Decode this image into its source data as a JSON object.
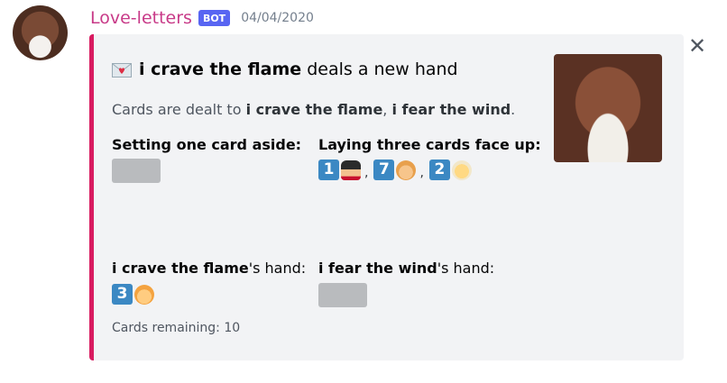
{
  "message": {
    "username": "Love-letters",
    "bot_tag": "BOT",
    "timestamp": "04/04/2020"
  },
  "embed": {
    "accent_color": "#d81b60",
    "title_icon": "love-letter-emoji",
    "title_bold": "i crave the flame",
    "title_rest": " deals a new hand",
    "desc_prefix": "Cards are dealt to ",
    "desc_player1": "i crave the flame",
    "desc_sep": ", ",
    "desc_player2": "i fear the wind",
    "desc_end": ".",
    "fields": {
      "aside_label": "Setting one card aside:",
      "faceup_label": "Laying three cards face up:",
      "faceup_cards": [
        {
          "number": "1",
          "icon": "guard-emoji"
        },
        {
          "number": "7",
          "icon": "princess-emoji"
        },
        {
          "number": "2",
          "icon": "older-person-emoji"
        }
      ],
      "faceup_separator": ",",
      "hand1_player": "i crave the flame",
      "hand1_suffix": "'s hand:",
      "hand1_cards": [
        {
          "number": "3",
          "icon": "person-emoji"
        }
      ],
      "hand2_player": "i fear the wind",
      "hand2_suffix": "'s hand:"
    },
    "footer": "Cards remaining: 10"
  },
  "close_icon": "close-icon"
}
